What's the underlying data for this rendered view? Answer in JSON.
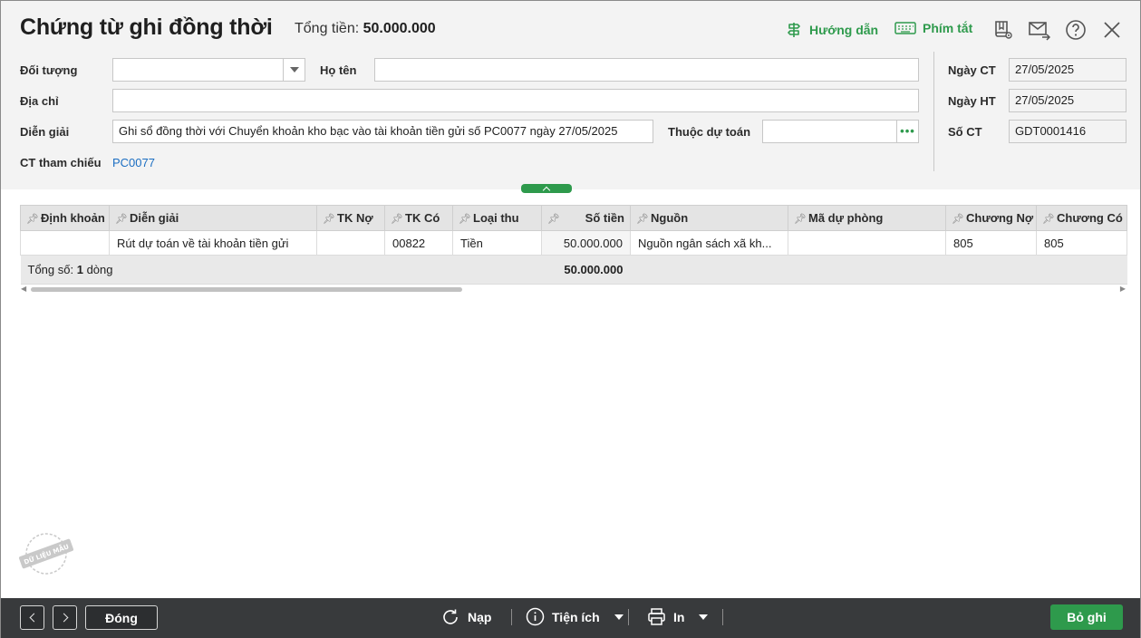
{
  "header": {
    "title": "Chứng từ ghi đồng thời",
    "total_label": "Tổng tiền:",
    "total_value": "50.000.000",
    "guide_label": "Hướng dẫn",
    "shortcut_label": "Phím tắt"
  },
  "form": {
    "doi_tuong_label": "Đối tượng",
    "doi_tuong_value": "",
    "ho_ten_label": "Họ tên",
    "ho_ten_value": "",
    "dia_chi_label": "Địa chỉ",
    "dia_chi_value": "",
    "dien_giai_label": "Diễn giải",
    "dien_giai_value": "Ghi sổ đồng thời với Chuyển khoản kho bạc vào tài khoản tiền gửi số PC0077 ngày 27/05/2025",
    "thuoc_du_toan_label": "Thuộc dự toán",
    "thuoc_du_toan_value": "",
    "ct_tham_chieu_label": "CT tham chiếu",
    "ct_tham_chieu_value": "PC0077",
    "ngay_ct_label": "Ngày CT",
    "ngay_ct_value": "27/05/2025",
    "ngay_ht_label": "Ngày HT",
    "ngay_ht_value": "27/05/2025",
    "so_ct_label": "Số CT",
    "so_ct_value": "GDT0001416"
  },
  "grid": {
    "columns": [
      "Định khoản",
      "Diễn giải",
      "TK Nợ",
      "TK Có",
      "Loại thu",
      "Số tiền",
      "Nguồn",
      "Mã dự phòng",
      "Chương Nợ",
      "Chương Có"
    ],
    "rows": [
      [
        "",
        "Rút dự toán về tài khoản tiền gửi",
        "",
        "00822",
        "Tiền",
        "50.000.000",
        "Nguồn ngân sách xã kh...",
        "",
        "805",
        "805"
      ]
    ],
    "summary_prefix": "Tổng số:",
    "summary_count": "1",
    "summary_suffix": "dòng",
    "summary_amount": "50.000.000"
  },
  "stamp": {
    "text": "DỮ LIỆU MẪU"
  },
  "footer": {
    "close_label": "Đóng",
    "reload_label": "Nạp",
    "utility_label": "Tiện ích",
    "print_label": "In",
    "unpost_label": "Bỏ ghi"
  },
  "colors": {
    "accent": "#2e9a4c",
    "link": "#1b6ec2",
    "footer_bg": "#383a3c"
  }
}
